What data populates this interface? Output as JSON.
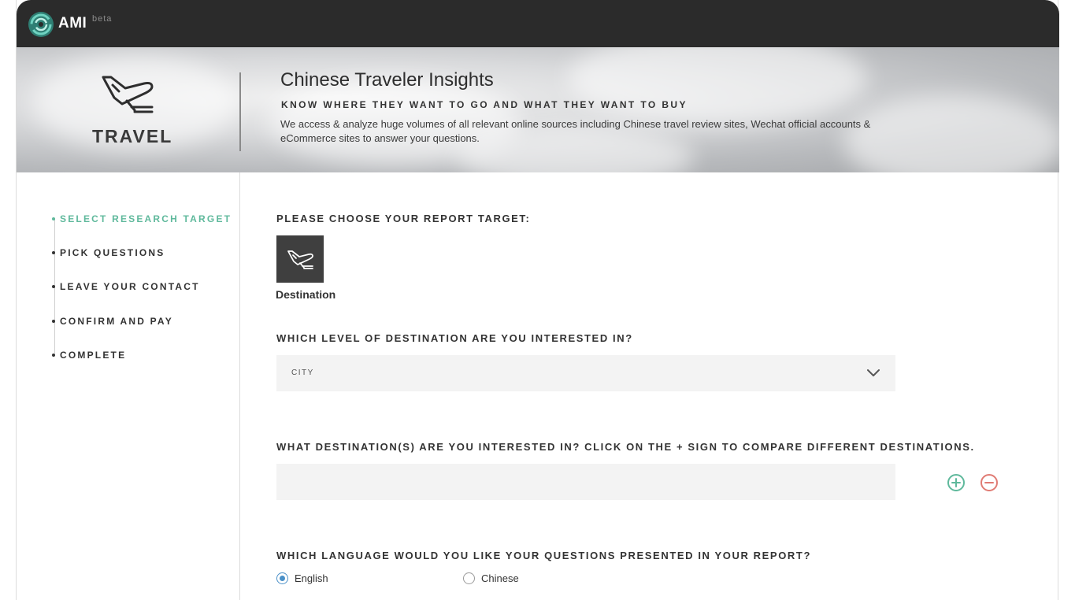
{
  "header": {
    "brand": "AMI",
    "badge": "beta"
  },
  "hero": {
    "category": "TRAVEL",
    "title": "Chinese Traveler Insights",
    "subtitle": "KNOW WHERE THEY WANT TO GO AND WHAT THEY WANT TO BUY",
    "description": "We access & analyze huge volumes of all relevant online sources including Chinese travel review sites, Wechat official accounts & eCommerce sites to answer your questions."
  },
  "steps": [
    {
      "label": "SELECT RESEARCH TARGET",
      "active": true
    },
    {
      "label": "PICK QUESTIONS",
      "active": false
    },
    {
      "label": "LEAVE YOUR CONTACT",
      "active": false
    },
    {
      "label": "CONFIRM AND PAY",
      "active": false
    },
    {
      "label": "COMPLETE",
      "active": false
    }
  ],
  "form": {
    "target_question": "PLEASE CHOOSE YOUR REPORT TARGET:",
    "target_option": "Destination",
    "level_question": "WHICH LEVEL OF DESTINATION ARE YOU INTERESTED IN?",
    "level_value": "CITY",
    "destinations_question": "WHAT DESTINATION(S) ARE YOU INTERESTED IN? CLICK ON THE + SIGN TO COMPARE DIFFERENT DESTINATIONS.",
    "destination_value": "",
    "language_question": "WHICH LANGUAGE WOULD YOU LIKE YOUR QUESTIONS PRESENTED IN YOUR REPORT?",
    "languages": [
      {
        "label": "English",
        "selected": true
      },
      {
        "label": "Chinese",
        "selected": false
      }
    ]
  },
  "colors": {
    "accent": "#5fb99c",
    "remove": "#e07b74",
    "radio": "#4a90c8",
    "topbar": "#2b2b2b"
  }
}
